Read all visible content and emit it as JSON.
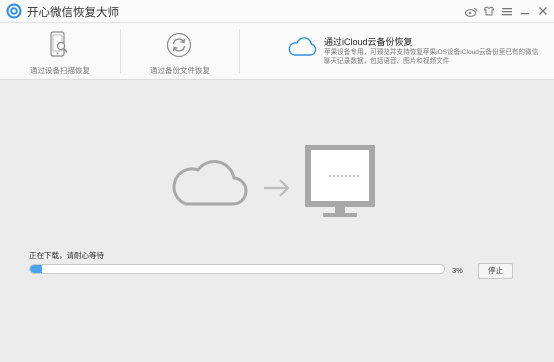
{
  "window": {
    "title": "开心微信恢复大师"
  },
  "titlebar_icons": [
    "weibo-icon",
    "skin-icon",
    "menu-icon",
    "minimize-icon",
    "close-icon"
  ],
  "tabs": [
    {
      "label": "通过设备扫描恢复",
      "icon": "phone-search-icon"
    },
    {
      "label": "通过备份文件恢复",
      "icon": "backup-refresh-icon"
    },
    {
      "title": "通过iCloud云备份恢复",
      "description": "苹果设备专用，可预览并支持恢复苹果iOS设备iCloud云备份里已有的微信聊天记录数据，包括语音、图片和视频文件",
      "icon": "cloud-icon",
      "active": true
    }
  ],
  "illustration": {
    "left_icon": "cloud-icon",
    "arrow_icon": "arrow-right-icon",
    "right_icon": "monitor-icon"
  },
  "download": {
    "status": "正在下载，请耐心等待",
    "progress_percent": 3,
    "progress_text": "3%",
    "pause_label": "停止"
  },
  "colors": {
    "accent": "#4aa3f0",
    "background": "#ececec",
    "icon_gray": "#a8a8a8"
  }
}
